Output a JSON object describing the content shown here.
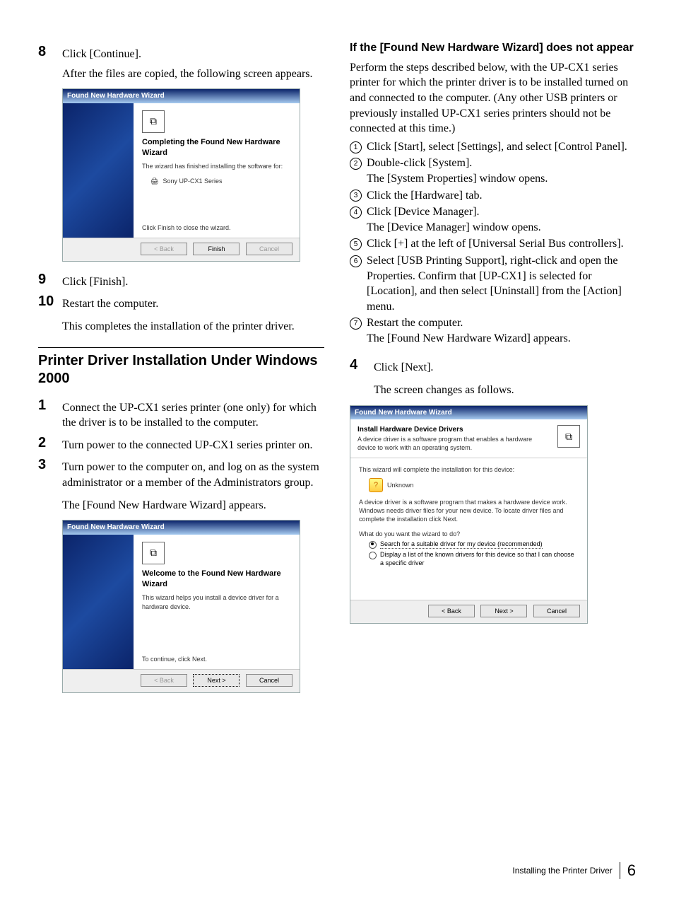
{
  "left": {
    "step8_num": "8",
    "step8_text": "Click [Continue].",
    "step8_after": "After the files are copied, the following screen appears.",
    "dlg1": {
      "title": "Found New Hardware Wizard",
      "heading": "Completing the Found New Hardware Wizard",
      "line1": "The wizard has finished installing the software for:",
      "device": "Sony UP-CX1 Series",
      "closing": "Click Finish to close the wizard.",
      "back": "< Back",
      "finish": "Finish",
      "cancel": "Cancel"
    },
    "step9_num": "9",
    "step9_text": "Click [Finish].",
    "step10_num": "10",
    "step10_text": "Restart the computer.",
    "step10_after": "This completes the installation of the printer driver.",
    "section": "Printer Driver Installation Under Windows 2000",
    "w2k_step1_num": "1",
    "w2k_step1_text": "Connect the UP-CX1 series printer (one only) for which the driver is to be installed to the computer.",
    "w2k_step2_num": "2",
    "w2k_step2_text": "Turn power to the connected UP-CX1 series printer on.",
    "w2k_step3_num": "3",
    "w2k_step3_text": "Turn power to the computer on, and log on as the system administrator or a member of the Administrators group.",
    "w2k_step3_after": "The [Found New Hardware Wizard] appears.",
    "dlg2": {
      "title": "Found New Hardware Wizard",
      "heading": "Welcome to the Found New Hardware Wizard",
      "line1": "This wizard helps you install a device driver for a hardware device.",
      "closing": "To continue, click Next.",
      "back": "< Back",
      "next": "Next >",
      "cancel": "Cancel"
    }
  },
  "right": {
    "sub_heading": "If the [Found New Hardware Wizard] does not appear",
    "intro": "Perform the steps described below, with the UP-CX1 series printer for which the printer driver is to be installed turned on and connected to the computer. (Any other USB printers or previously installed UP-CX1 series printers should not be connected at this time.)",
    "enum": [
      {
        "n": "1",
        "t": "Click [Start], select [Settings], and select [Control Panel]."
      },
      {
        "n": "2",
        "t": "Double-click [System].",
        "t2": "The [System Properties] window opens."
      },
      {
        "n": "3",
        "t": "Click the [Hardware] tab."
      },
      {
        "n": "4",
        "t": "Click [Device Manager].",
        "t2": "The [Device Manager] window opens."
      },
      {
        "n": "5",
        "t": "Click [+] at the left of [Universal Serial Bus controllers]."
      },
      {
        "n": "6",
        "t": "Select [USB Printing Support], right-click and open the Properties. Confirm that [UP-CX1] is selected for [Location], and then select [Uninstall] from the [Action] menu."
      },
      {
        "n": "7",
        "t": "Restart the computer.",
        "t2": "The [Found New Hardware Wizard] appears."
      }
    ],
    "step4_num": "4",
    "step4_text": "Click [Next].",
    "step4_after": "The screen changes as follows.",
    "dlg3": {
      "title": "Found New Hardware Wizard",
      "banner_h": "Install Hardware Device Drivers",
      "banner_t": "A device driver is a software program that enables a hardware device to work with an operating system.",
      "line1": "This wizard will complete the installation for this device:",
      "unknown": "Unknown",
      "desc": "A device driver is a software program that makes a hardware device work. Windows needs driver files for your new device. To locate driver files and complete the installation click Next.",
      "q": "What do you want the wizard to do?",
      "opt1": "Search for a suitable driver for my device (recommended)",
      "opt2": "Display a list of the known drivers for this device so that I can choose a specific driver",
      "back": "< Back",
      "next": "Next >",
      "cancel": "Cancel"
    }
  },
  "footer": {
    "label": "Installing the Printer Driver",
    "page": "6"
  }
}
